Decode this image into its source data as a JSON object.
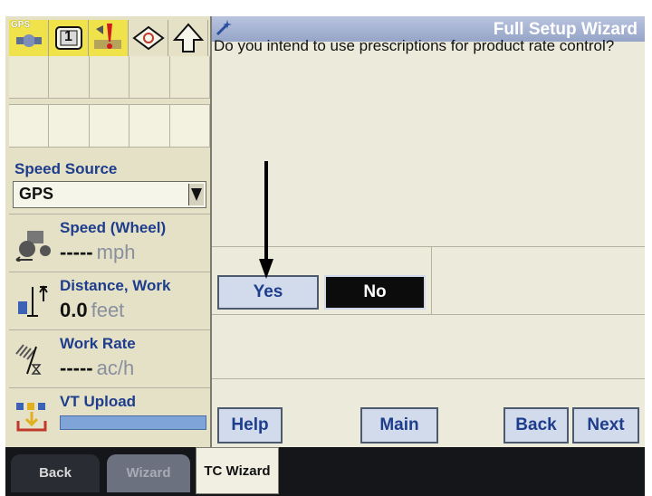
{
  "left_panel": {
    "top_icons": {
      "gps_label": "GPS",
      "section_count": "1"
    },
    "speed_source": {
      "label": "Speed Source",
      "value": "GPS"
    },
    "metrics": [
      {
        "label": "Speed (Wheel)",
        "value": "-----",
        "unit": "mph",
        "icon": "tractor-speed-icon"
      },
      {
        "label": "Distance, Work",
        "value": "0.0",
        "unit": "feet",
        "icon": "distance-work-icon"
      },
      {
        "label": "Work Rate",
        "value": "-----",
        "unit": "ac/h",
        "icon": "work-rate-icon"
      },
      {
        "label": "VT Upload",
        "icon": "vt-upload-icon",
        "progress": 1.0
      }
    ]
  },
  "wizard": {
    "title": "Full Setup Wizard",
    "question": "Do you intend to use prescriptions for product rate control?",
    "yes_label": "Yes",
    "no_label": "No",
    "help_label": "Help",
    "main_label": "Main",
    "back_label": "Back",
    "next_label": "Next"
  },
  "tabs": [
    {
      "label": "Back"
    },
    {
      "label": "Wizard"
    },
    {
      "label": "TC Wizard"
    }
  ],
  "colors": {
    "accent_blue": "#1e3d8c",
    "panel_bg": "#e4e1c7",
    "title_bar": "#95a4c8",
    "alert_yellow": "#efe24a"
  }
}
